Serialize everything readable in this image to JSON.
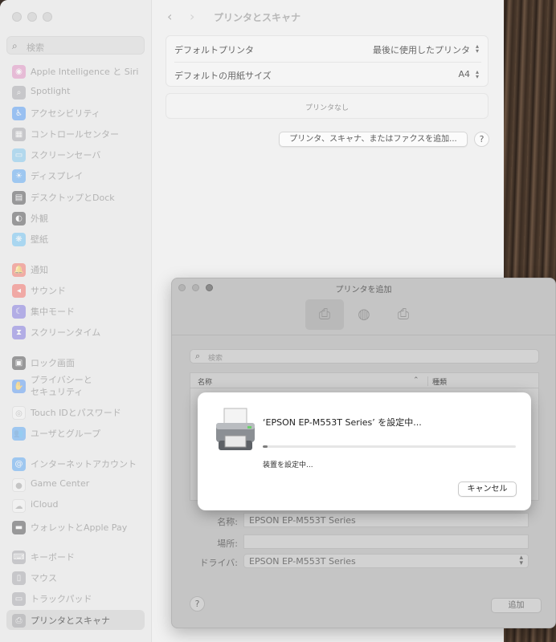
{
  "sidebar": {
    "search_placeholder": "検索",
    "items": [
      {
        "label": "Apple Intelligence と Siri",
        "icon": "siri-icon",
        "color": "#d86fb0",
        "glyph": "◉"
      },
      {
        "label": "Spotlight",
        "icon": "spotlight-icon",
        "color": "#8e8e93",
        "glyph": "⌕"
      },
      {
        "label": "アクセシビリティ",
        "icon": "accessibility-icon",
        "color": "#1e7cf2",
        "glyph": "♿"
      },
      {
        "label": "コントロールセンター",
        "icon": "control-center-icon",
        "color": "#8e8e93",
        "glyph": "▦"
      },
      {
        "label": "スクリーンセーバ",
        "icon": "screensaver-icon",
        "color": "#5ab5e8",
        "glyph": "▭"
      },
      {
        "label": "ディスプレイ",
        "icon": "display-icon",
        "color": "#2a8cf0",
        "glyph": "☀"
      },
      {
        "label": "デスクトップとDock",
        "icon": "desktop-dock-icon",
        "color": "#1c1c1e",
        "glyph": "▤"
      },
      {
        "label": "外観",
        "icon": "appearance-icon",
        "color": "#1c1c1e",
        "glyph": "◐"
      },
      {
        "label": "壁紙",
        "icon": "wallpaper-icon",
        "color": "#46b3f0",
        "glyph": "❋"
      },
      {
        "label": "通知",
        "icon": "notifications-icon",
        "color": "#f04a3c",
        "glyph": "🔔"
      },
      {
        "label": "サウンド",
        "icon": "sound-icon",
        "color": "#f0453a",
        "glyph": "◂"
      },
      {
        "label": "集中モード",
        "icon": "focus-icon",
        "color": "#5b4fd6",
        "glyph": "☾"
      },
      {
        "label": "スクリーンタイム",
        "icon": "screen-time-icon",
        "color": "#5b4fd6",
        "glyph": "⧗"
      },
      {
        "label": "ロック画面",
        "icon": "lock-screen-icon",
        "color": "#1c1c1e",
        "glyph": "▣"
      },
      {
        "label": "プライバシーと\nセキュリティ",
        "icon": "privacy-hand-icon",
        "color": "#2a7cf0",
        "glyph": "✋"
      },
      {
        "label": "Touch IDとパスワード",
        "icon": "touch-id-icon",
        "color": "#f2f2f2",
        "glyph": "◎"
      },
      {
        "label": "ユーザとグループ",
        "icon": "users-groups-icon",
        "color": "#2a8cf0",
        "glyph": "👥"
      },
      {
        "label": "インターネットアカウント",
        "icon": "internet-accounts-icon",
        "color": "#2a8cf0",
        "glyph": "@"
      },
      {
        "label": "Game Center",
        "icon": "game-center-icon",
        "color": "#f2f2f2",
        "glyph": "●"
      },
      {
        "label": "iCloud",
        "icon": "icloud-icon",
        "color": "#f2f2f2",
        "glyph": "☁"
      },
      {
        "label": "ウォレットとApple Pay",
        "icon": "wallet-icon",
        "color": "#1c1c1e",
        "glyph": "▬"
      },
      {
        "label": "キーボード",
        "icon": "keyboard-icon",
        "color": "#8e8e93",
        "glyph": "⌨"
      },
      {
        "label": "マウス",
        "icon": "mouse-icon",
        "color": "#8e8e93",
        "glyph": "▯"
      },
      {
        "label": "トラックパッド",
        "icon": "trackpad-icon",
        "color": "#8e8e93",
        "glyph": "▭"
      },
      {
        "label": "プリンタとスキャナ",
        "icon": "printer-icon",
        "color": "#8e8e93",
        "glyph": "⎙"
      }
    ]
  },
  "main": {
    "title": "プリンタとスキャナ",
    "default_printer_label": "デフォルトプリンタ",
    "default_printer_value": "最後に使用したプリンタ",
    "paper_size_label": "デフォルトの用紙サイズ",
    "paper_size_value": "A4",
    "no_printers": "プリンタなし",
    "add_button": "プリンタ、スキャナ、またはファクスを追加...",
    "help": "?"
  },
  "add_window": {
    "title": "プリンタを追加",
    "search_placeholder": "検索",
    "col_name": "名称",
    "col_kind": "種類",
    "name_label": "名称:",
    "name_value": "EPSON EP-M553T Series",
    "location_label": "場所:",
    "location_value": "",
    "driver_label": "ドライバ:",
    "driver_value": "EPSON EP-M553T Series",
    "help": "?",
    "add_button": "追加"
  },
  "sheet": {
    "title": "‘EPSON EP-M553T Series’ を設定中...",
    "status": "装置を設定中...",
    "progress_fraction": 0.02,
    "cancel_button": "キャンセル"
  }
}
